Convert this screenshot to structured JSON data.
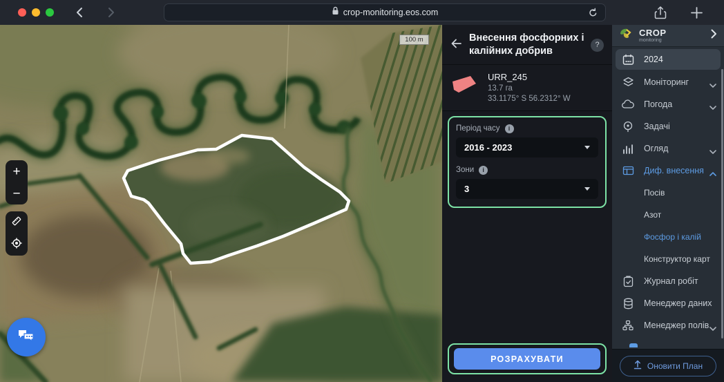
{
  "browser": {
    "url": "crop-monitoring.eos.com"
  },
  "map": {
    "scale_label": "100 m",
    "zoom_in": "+",
    "zoom_out": "−"
  },
  "panel": {
    "title_line1": "Внесення фосфорних і",
    "title_line2": "калійних добрив",
    "help": "?",
    "field": {
      "name": "URR_245",
      "area": "13.7 га",
      "coords": "33.1175° S 56.2312° W"
    },
    "form": {
      "period_label": "Період часу",
      "period_info": "i",
      "period_value": "2016 - 2023",
      "zones_label": "Зони",
      "zones_info": "i",
      "zones_value": "3"
    },
    "calculate_label": "РОЗРАХУВАТИ"
  },
  "sidebar": {
    "brand_name": "CROP",
    "brand_sub": "monitoring",
    "items": {
      "year": "2024",
      "monitoring": "Моніторинг",
      "weather": "Погода",
      "tasks": "Задачі",
      "overview": "Огляд",
      "vra": "Диф. внесення",
      "sowing": "Посів",
      "nitrogen": "Азот",
      "phosphorus": "Фосфор і калій",
      "map_builder": "Конструктор карт",
      "work_log": "Журнал робіт",
      "data_manager": "Менеджер даних",
      "field_manager": "Менеджер полів"
    },
    "upgrade_label": "Оновити План"
  },
  "colors": {
    "accent_blue": "#5a8cec",
    "active_link": "#5d9be2",
    "highlight_green": "#7de3a6",
    "field_outline": "#ffffff",
    "field_shape_pink": "#ef8383"
  }
}
